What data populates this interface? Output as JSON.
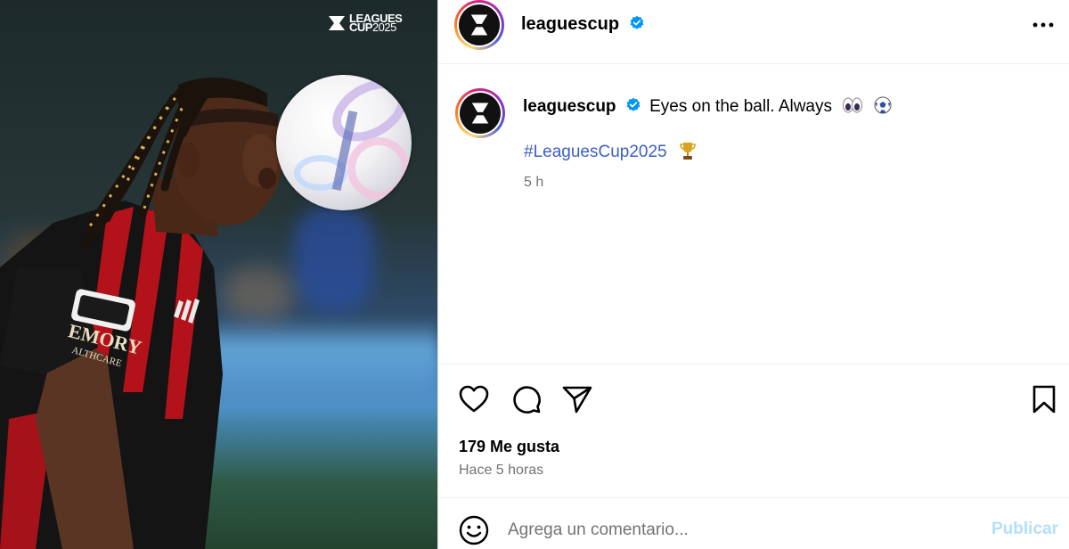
{
  "media": {
    "logo_line1": "LEAGUES",
    "logo_line2_a": "CUP",
    "logo_line2_b": "2025",
    "jersey_text_1": "EMORY",
    "jersey_text_2": "ALTHCARE"
  },
  "header": {
    "username": "leaguescup",
    "verified": true,
    "more_icon": "more-horizontal-icon"
  },
  "post": {
    "username": "leaguescup",
    "caption": "Eyes on the ball. Always",
    "hashtag": "#LeaguesCup2025",
    "time": "5 h",
    "emojis": [
      "eyes",
      "soccer-ball",
      "trophy"
    ]
  },
  "actions": {
    "icons": [
      "heart-icon",
      "comment-icon",
      "share-icon",
      "bookmark-icon"
    ],
    "likes": "179 Me gusta",
    "posted": "Hace 5 horas"
  },
  "comment": {
    "placeholder": "Agrega un comentario...",
    "publish_label": "Publicar"
  },
  "colors": {
    "link": "#3b5fc4",
    "muted": "#737373",
    "publish_disabled": "#b2dffc",
    "verified": "#0095f6"
  }
}
